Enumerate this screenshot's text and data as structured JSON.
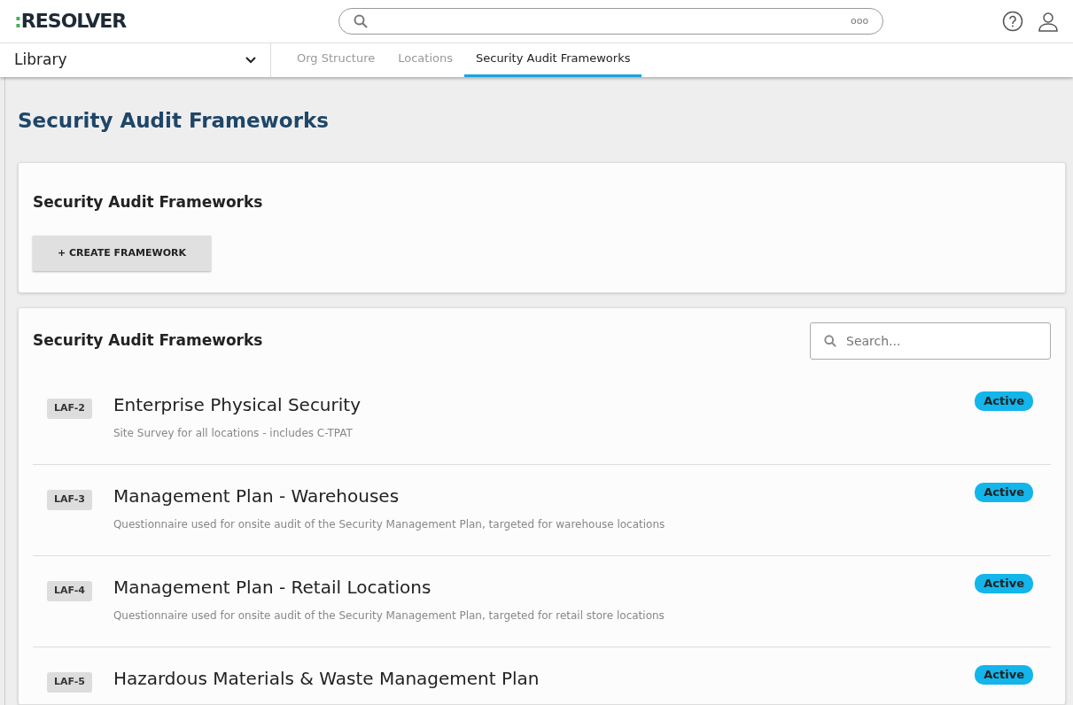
{
  "header": {
    "logo": ":RESOLVER",
    "search": {
      "more": "ooo"
    }
  },
  "nav": {
    "dropdown": "Library",
    "tabs": [
      {
        "label": "Org Structure",
        "selected": false
      },
      {
        "label": "Locations",
        "selected": false
      },
      {
        "label": "Security Audit Frameworks",
        "selected": true
      }
    ]
  },
  "page_title": "Security Audit Frameworks",
  "create_card": {
    "title": "Security Audit Frameworks",
    "button": "+ CREATE FRAMEWORK"
  },
  "list_card": {
    "title": "Security Audit Frameworks",
    "search": {
      "placeholder": "Search..."
    },
    "items": [
      {
        "id": "LAF-2",
        "name": "Enterprise Physical Security",
        "description": "Site Survey for all locations - includes C-TPAT",
        "status": "Active"
      },
      {
        "id": "LAF-3",
        "name": "Management Plan - Warehouses",
        "description": "Questionnaire used for onsite audit of the Security Management Plan, targeted for warehouse locations",
        "status": "Active"
      },
      {
        "id": "LAF-4",
        "name": "Management Plan - Retail Locations",
        "description": "Questionnaire used for onsite audit of the Security Management Plan, targeted for retail store locations",
        "status": "Active"
      },
      {
        "id": "LAF-5",
        "name": "Hazardous Materials & Waste Management Plan",
        "status": "Active"
      }
    ]
  }
}
